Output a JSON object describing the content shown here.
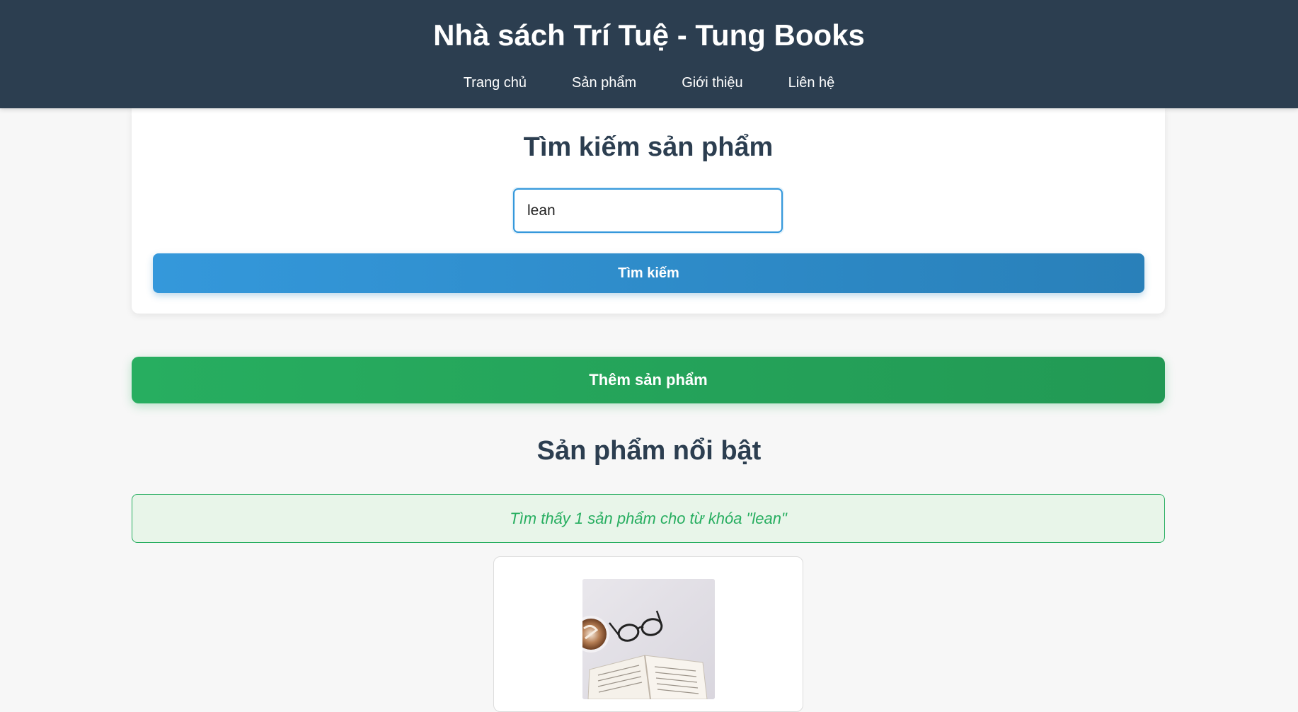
{
  "header": {
    "site_title": "Nhà sách Trí Tuệ - Tung Books",
    "nav": [
      {
        "label": "Trang chủ"
      },
      {
        "label": "Sản phẩm"
      },
      {
        "label": "Giới thiệu"
      },
      {
        "label": "Liên hệ"
      }
    ]
  },
  "search": {
    "title": "Tìm kiếm sản phẩm",
    "input_value": "lean",
    "button_label": "Tìm kiếm"
  },
  "add_product": {
    "button_label": "Thêm sản phẩm"
  },
  "featured": {
    "title": "Sản phẩm nổi bật",
    "result_message": "Tìm thấy 1 sản phẩm cho từ khóa \"lean\""
  },
  "colors": {
    "header_bg": "#2c3e50",
    "primary_blue": "#3498db",
    "success_green": "#27ae60",
    "page_bg": "#f7f7f7"
  }
}
